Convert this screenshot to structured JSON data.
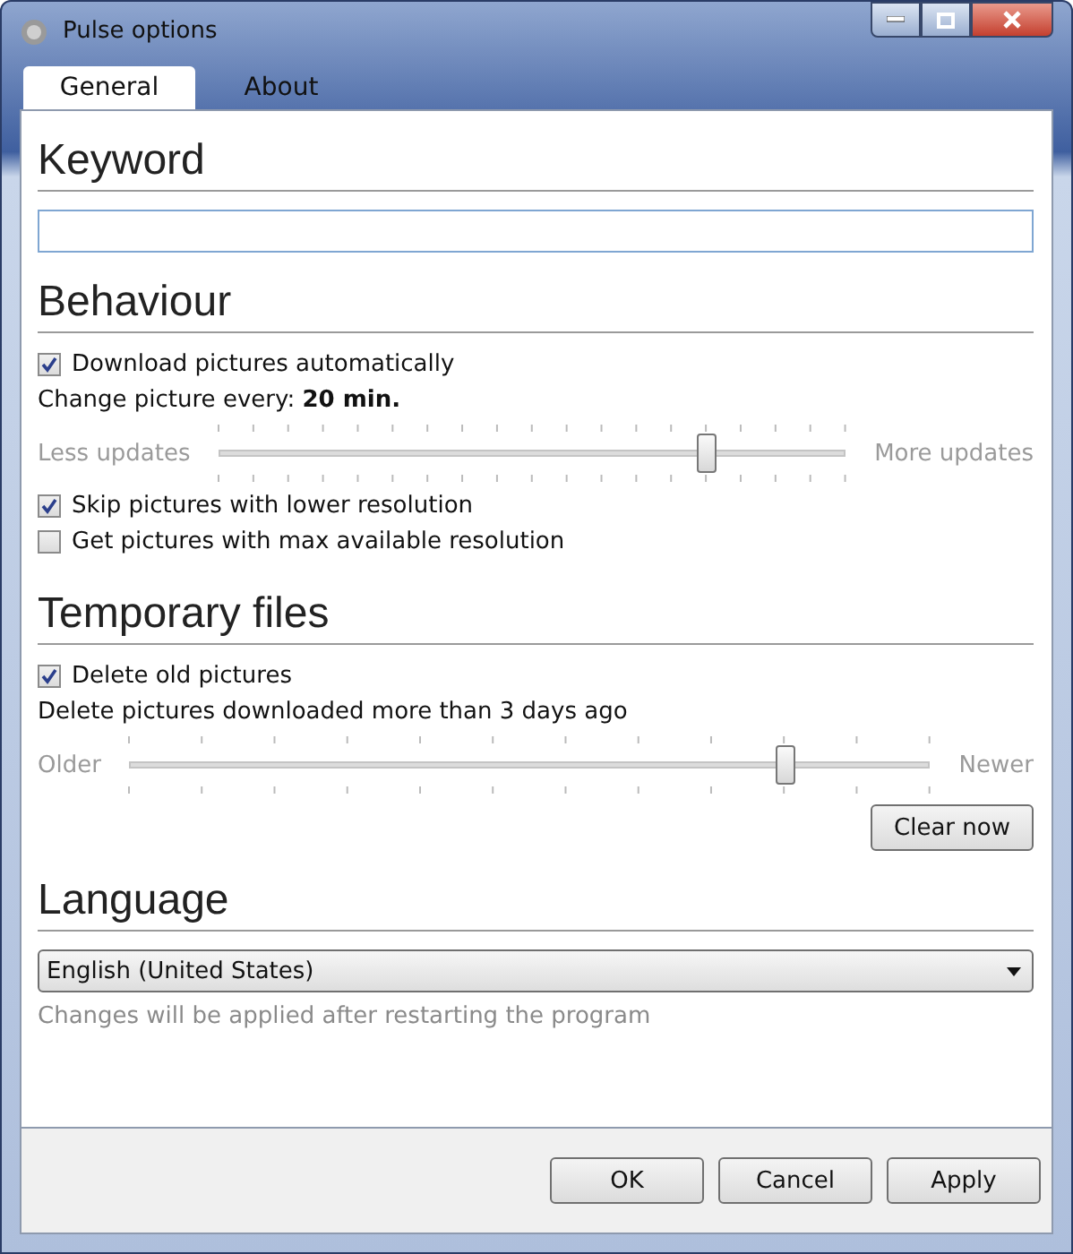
{
  "window": {
    "title": "Pulse options"
  },
  "tabs": [
    {
      "label": "General",
      "selected": true
    },
    {
      "label": "About",
      "selected": false
    }
  ],
  "sections": [
    {
      "title": "Keyword",
      "items": [
        {
          "kind": "field",
          "value": ""
        }
      ]
    },
    {
      "title": "Behaviour",
      "items": [
        {
          "kind": "checkbox",
          "label": "Download pictures automatically",
          "checked": true
        },
        {
          "kind": "text",
          "label": "Change picture every: **20 min.**"
        },
        {
          "kind": "slider",
          "left": "Less updates",
          "right": "More updates",
          "level": 0.78
        },
        {
          "kind": "checkbox",
          "label": "Skip pictures with lower resolution",
          "checked": true
        },
        {
          "kind": "checkbox",
          "label": "Get pictures with max available resolution",
          "checked": false
        }
      ]
    },
    {
      "title": "Temporary files",
      "items": [
        {
          "kind": "checkbox",
          "label": "Delete old pictures",
          "checked": true
        },
        {
          "kind": "text",
          "label": "Delete pictures downloaded more than 3 days ago"
        },
        {
          "kind": "slider",
          "left": "Older",
          "right": "Newer",
          "level": 0.82
        },
        {
          "kind": "button",
          "label": "Clear now"
        }
      ]
    },
    {
      "title": "Language",
      "items": [
        {
          "kind": "select",
          "value": "English (United States)"
        },
        {
          "kind": "note",
          "label": "Changes will be applied after restarting the program"
        }
      ]
    }
  ],
  "buttons": [
    {
      "label": "OK"
    },
    {
      "label": "Cancel"
    },
    {
      "label": "Apply"
    }
  ]
}
